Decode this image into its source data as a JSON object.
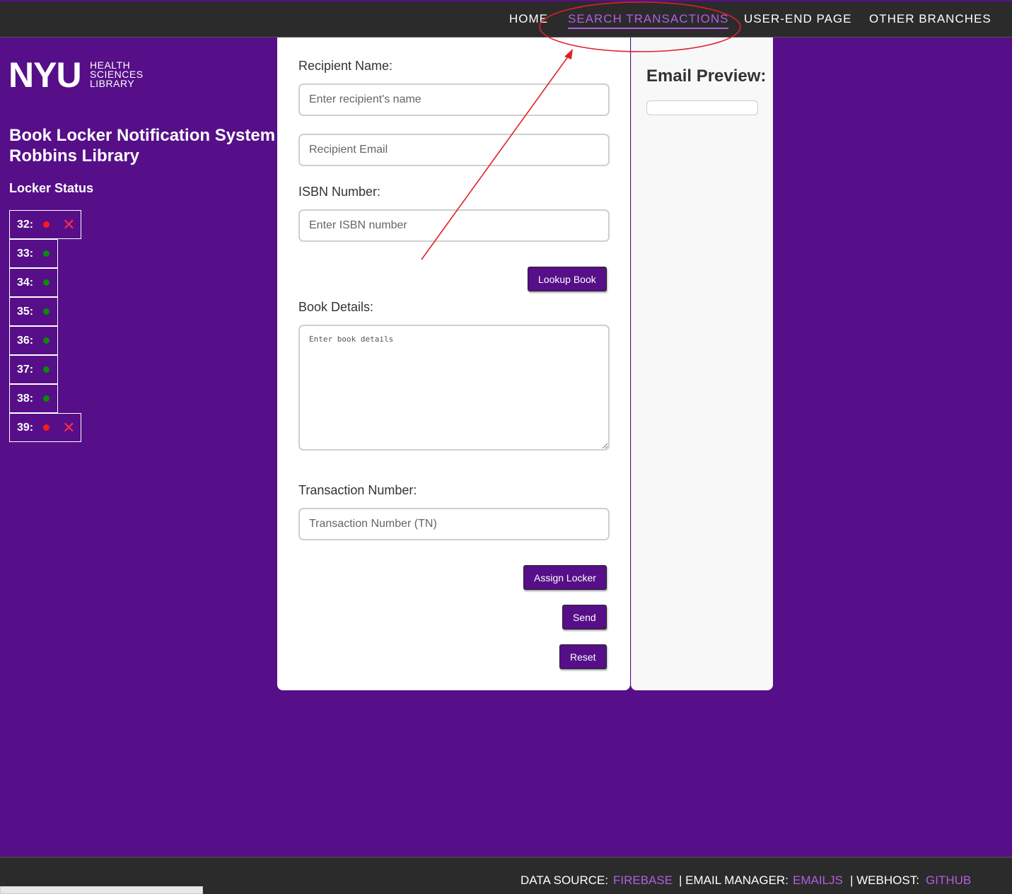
{
  "nav": {
    "home": "HOME",
    "search_transactions": "SEARCH TRANSACTIONS",
    "user_end_page": "USER-END PAGE",
    "other_branches": "OTHER BRANCHES"
  },
  "logo": {
    "main": "NYU",
    "line1": "HEALTH",
    "line2": "SCIENCES",
    "line3": "LIBRARY"
  },
  "sidebar": {
    "title_line1": "Book Locker Notification System",
    "title_line2": "Robbins Library",
    "locker_heading": "Locker Status",
    "lockers": [
      {
        "label": "32:",
        "status": "occupied"
      },
      {
        "label": "33:",
        "status": "available"
      },
      {
        "label": "34:",
        "status": "available"
      },
      {
        "label": "35:",
        "status": "available"
      },
      {
        "label": "36:",
        "status": "available"
      },
      {
        "label": "37:",
        "status": "available"
      },
      {
        "label": "38:",
        "status": "available"
      },
      {
        "label": "39:",
        "status": "occupied"
      }
    ]
  },
  "form": {
    "recipient_name_label": "Recipient Name:",
    "recipient_name_placeholder": "Enter recipient's name",
    "recipient_email_placeholder": "Recipient Email",
    "isbn_label": "ISBN Number:",
    "isbn_placeholder": "Enter ISBN number",
    "lookup_button": "Lookup Book",
    "book_details_label": "Book Details:",
    "book_details_placeholder": "Enter book details",
    "transaction_label": "Transaction Number:",
    "transaction_placeholder": "Transaction Number (TN)",
    "assign_button": "Assign Locker",
    "send_button": "Send",
    "reset_button": "Reset"
  },
  "preview": {
    "title": "Email Preview:"
  },
  "footer": {
    "data_source_label": "DATA SOURCE:",
    "data_source_link": "FIREBASE",
    "email_manager_label": "| EMAIL MANAGER:",
    "email_manager_link": "EMAILJS",
    "webhost_label": "| WEBHOST:",
    "webhost_link": "GITHUB"
  },
  "colors": {
    "page_bg": "#560f88",
    "nav_bg": "#2b2b2b",
    "accent_link": "#b35ee0",
    "button_bg": "#560f88",
    "annotation": "#e0202a"
  }
}
